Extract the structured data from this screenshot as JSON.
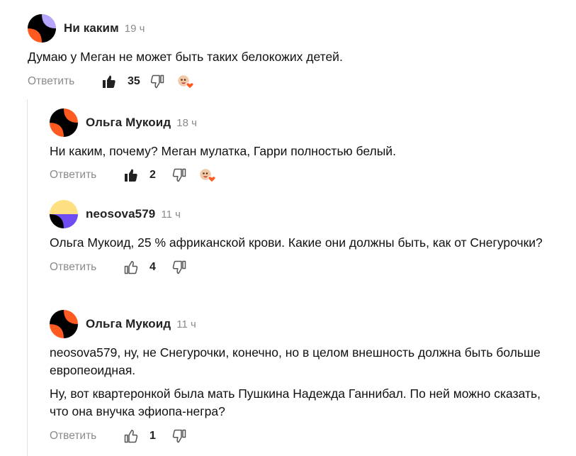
{
  "ui": {
    "reply_label": "Ответить"
  },
  "comments": [
    {
      "author": "Ни каким",
      "time": "19 ч",
      "paragraphs": [
        "Думаю у Меган не может быть таких белокожих детей."
      ],
      "likes": "35",
      "liked": true,
      "has_reactions": true
    },
    {
      "author": "Ольга Мукоид",
      "time": "18 ч",
      "paragraphs": [
        "Ни каким, почему? Меган мулатка, Гарри полностью белый."
      ],
      "likes": "2",
      "liked": true,
      "has_reactions": true
    },
    {
      "author": "neosova579",
      "time": "11 ч",
      "paragraphs": [
        "Ольга Мукоид, 25 % африканской крови. Какие они должны быть, как от Снегурочки?"
      ],
      "likes": "4",
      "liked": false,
      "has_reactions": false
    },
    {
      "author": "Ольга Мукоид",
      "time": "11 ч",
      "paragraphs": [
        "neosova579, ну, не Снегурочки, конечно, но в целом внешность должна быть больше европеоидная.",
        "Ну, вот квартеронкой была мать Пушкина Надежда Ганнибал. По ней можно сказать, что она внучка эфиопа-негра?"
      ],
      "likes": "1",
      "liked": false,
      "has_reactions": false
    }
  ],
  "colors": {
    "accent_orange": "#ff5a1f",
    "accent_pink": "#ffb3d9",
    "accent_purple": "#b7a6ff",
    "accent_yellow": "#ffe080",
    "accent_indigo": "#6f4bf2",
    "muted_text": "#8a8a8a"
  },
  "icons": {
    "like_filled": "thumbs-up-filled-icon",
    "like_outline": "thumbs-up-outline-icon",
    "dislike": "thumbs-down-icon",
    "reactions": "reactions-icon"
  }
}
